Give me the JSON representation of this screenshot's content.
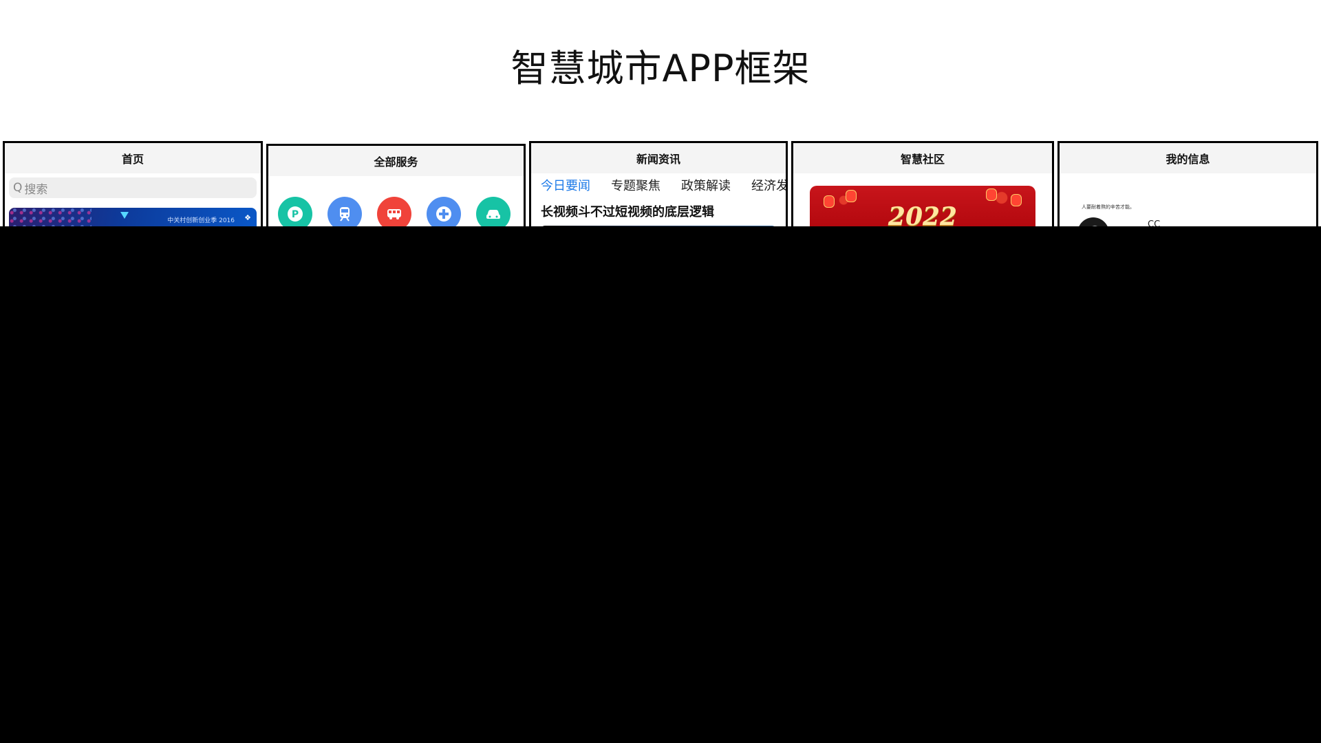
{
  "page": {
    "title": "智慧城市APP框架"
  },
  "frames": [
    {
      "title": "首页"
    },
    {
      "title": "全部服务"
    },
    {
      "title": "新闻资讯"
    },
    {
      "title": "智慧社区"
    },
    {
      "title": "我的信息"
    }
  ],
  "home": {
    "search_placeholder": "搜索",
    "banner_caption": "中关村创新创业季 2016"
  },
  "services": {
    "icons": [
      {
        "name": "parking-icon",
        "color": "#17c3a5"
      },
      {
        "name": "metro-icon",
        "color": "#4f8ef0"
      },
      {
        "name": "bus-icon",
        "color": "#f0433a"
      },
      {
        "name": "medical-cross-icon",
        "color": "#4f8ef0"
      },
      {
        "name": "car-icon",
        "color": "#17c3a5"
      }
    ]
  },
  "news": {
    "tabs": [
      "今日要闻",
      "专题聚焦",
      "政策解读",
      "经济发"
    ],
    "active_tab": 0,
    "headline": "长视频斗不过短视频的底层逻辑"
  },
  "community": {
    "banner_year": "2022"
  },
  "profile": {
    "tiny_text": "人要耐着熬的辛苦才能。",
    "nickname": "CC"
  },
  "colors": {
    "accent": "#1e7be8",
    "frame_border": "#000000",
    "cover": "#000000"
  }
}
